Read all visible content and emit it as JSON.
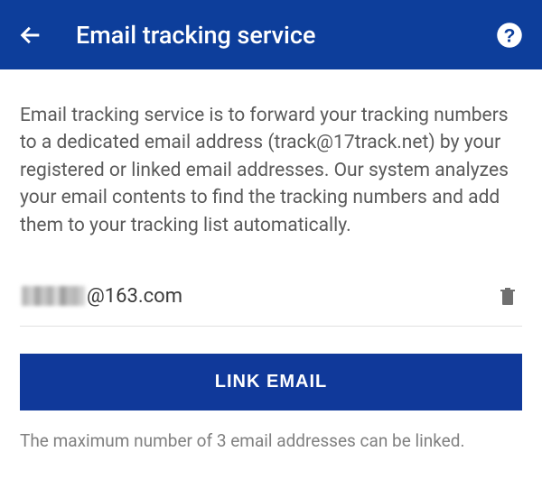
{
  "header": {
    "title": "Email tracking service"
  },
  "description": "Email tracking service is to forward your tracking numbers to a dedicated email address (track@17track.net) by your registered or linked email addresses. Our system analyzes your email contents to find the tracking numbers and add them to your tracking list automatically.",
  "email": {
    "domain": "@163.com"
  },
  "linkButton": {
    "label": "LINK EMAIL"
  },
  "footerNote": "The maximum number of 3 email addresses can be linked.",
  "colors": {
    "primary": "#0d3e9b"
  }
}
